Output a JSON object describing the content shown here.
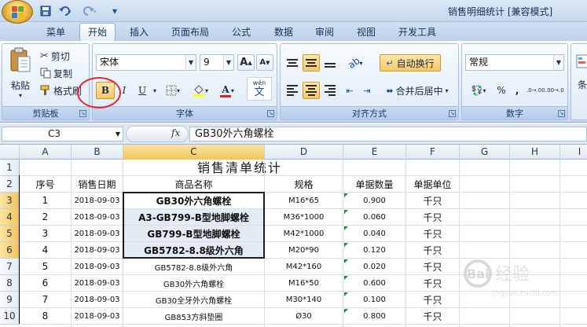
{
  "window": {
    "title": "销售明细统计  [兼容模式]"
  },
  "quick_access": {
    "save_icon": "save-icon",
    "undo_icon": "undo-icon",
    "redo_icon": "redo-icon"
  },
  "tabs": [
    {
      "label": "菜单"
    },
    {
      "label": "开始",
      "active": true
    },
    {
      "label": "插入"
    },
    {
      "label": "页面布局"
    },
    {
      "label": "公式"
    },
    {
      "label": "数据"
    },
    {
      "label": "审阅"
    },
    {
      "label": "视图"
    },
    {
      "label": "开发工具"
    }
  ],
  "ribbon": {
    "clipboard": {
      "group_label": "剪贴板",
      "paste_label": "粘贴",
      "cut_label": "剪切",
      "copy_label": "复制",
      "format_painter_label": "格式刷"
    },
    "font": {
      "group_label": "字体",
      "font_name": "宋体",
      "font_size": "9",
      "bold_label": "B",
      "italic_label": "I",
      "underline_label": "U",
      "phonetic_label": "wén",
      "phonetic_char": "文",
      "grow_label": "A",
      "shrink_label": "A",
      "font_color_label": "A"
    },
    "alignment": {
      "group_label": "对齐方式",
      "wrap_label": "自动换行",
      "merge_label": "合并后居中"
    },
    "number": {
      "group_label": "数字",
      "format": "常规",
      "percent_label": "%",
      "comma_label": ",",
      "inc_decimal_label": ".0→.00",
      "dec_decimal_label": ".00→.0"
    },
    "styles": {
      "partial_label": "条"
    }
  },
  "formula_bar": {
    "name_box": "C3",
    "fx_label": "fx",
    "formula": "GB30外六角螺栓"
  },
  "columns": [
    "A",
    "B",
    "C",
    "D",
    "E",
    "F",
    "G",
    "H",
    "I"
  ],
  "rows": [
    "1",
    "2",
    "3",
    "4",
    "5",
    "6",
    "7",
    "8",
    "9",
    "10"
  ],
  "sheet": {
    "title": "销售清单统计",
    "headers": [
      "序号",
      "销售日期",
      "商品名称",
      "规格",
      "单据数量",
      "单据单位"
    ],
    "data": [
      [
        "1",
        "2018-09-03",
        "GB30外六角螺栓",
        "M16*65",
        "0.900",
        "千只"
      ],
      [
        "2",
        "2018-09-03",
        "A3-GB799-B型地脚螺栓",
        "M36*1000",
        "0.060",
        "千只"
      ],
      [
        "3",
        "2018-09-03",
        "GB799-B型地脚螺栓",
        "M42*1000",
        "0.040",
        "千只"
      ],
      [
        "4",
        "2018-09-03",
        "GB5782-8.8级外六角",
        "M20*90",
        "0.120",
        "千只"
      ],
      [
        "5",
        "2018-09-03",
        "GB5782-8.8级外六角",
        "M42*160",
        "0.020",
        "千只"
      ],
      [
        "6",
        "2018-09-03",
        "GB30外六角螺栓",
        "M16*50",
        "0.600",
        "千只"
      ],
      [
        "7",
        "2018-09-03",
        "GB30全牙外六角螺栓",
        "M30*140",
        "0.100",
        "千只"
      ],
      [
        "8",
        "2018-09-03",
        "GB853方斜垫圈",
        "Ø30",
        "0.800",
        "千只"
      ]
    ]
  },
  "watermark": {
    "text": "Bai 经验",
    "subtext": "jingyan.baidu.com"
  },
  "colors": {
    "accent": "#f2c45a",
    "annotation": "#e8252c"
  }
}
